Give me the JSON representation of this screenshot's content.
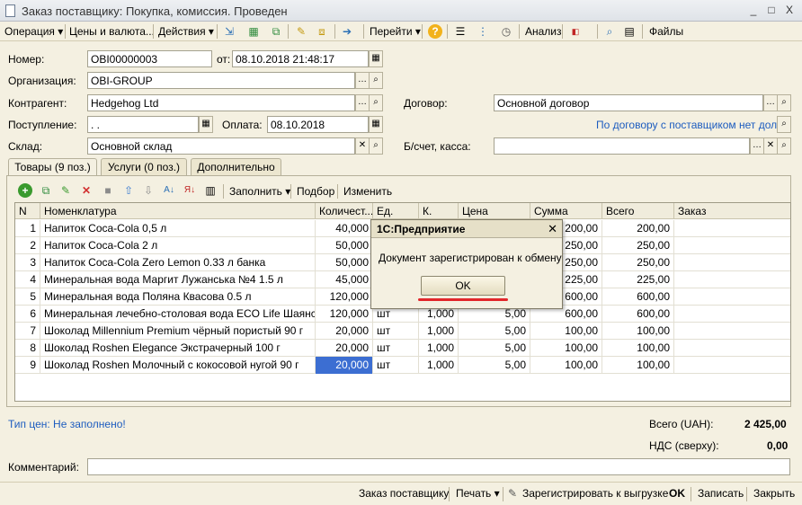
{
  "window": {
    "title": "Заказ поставщику: Покупка, комиссия. Проведен",
    "min": "_",
    "max": "□",
    "close": "X"
  },
  "toolbar": {
    "operation": "Операция ▾",
    "prices": "Цены и валюта...",
    "actions": "Действия ▾",
    "goto": "Перейти ▾",
    "analysis": "Анализ",
    "files": "Файлы",
    "help_glyph": "?"
  },
  "form": {
    "number_label": "Номер:",
    "number_value": "OBI00000003",
    "from_label": "от:",
    "date_value": "08.10.2018 21:48:17",
    "org_label": "Организация:",
    "org_value": "OBI-GROUP",
    "contractor_label": "Контрагент:",
    "contractor_value": "Hedgehog Ltd",
    "contract_label": "Договор:",
    "contract_value": "Основной договор",
    "receipt_label": "Поступление:",
    "receipt_value": " .  .",
    "payment_label": "Оплата:",
    "payment_value": "08.10.2018",
    "debt_link": "По договору с поставщиком нет долга",
    "warehouse_label": "Склад:",
    "warehouse_value": "Основной склад",
    "account_label": "Б/счет, касса:",
    "account_value": ""
  },
  "tabs": [
    {
      "label": "Товары (9 поз.)"
    },
    {
      "label": "Услуги (0 поз.)"
    },
    {
      "label": "Дополнительно"
    }
  ],
  "table_toolbar": {
    "fill": "Заполнить ▾",
    "pick": "Подбор",
    "change": "Изменить"
  },
  "columns": [
    "N",
    "Номенклатура",
    "Количест...",
    "Ед.",
    "К.",
    "Цена",
    "Сумма",
    "Всего",
    "Заказ"
  ],
  "rows": [
    {
      "n": "1",
      "name": "Напиток Coca-Cola 0,5 л",
      "qty": "40,000",
      "unit": "",
      "k": "",
      "price": "",
      "sum": "200,00",
      "total": "200,00"
    },
    {
      "n": "2",
      "name": "Напиток Coca-Cola 2 л",
      "qty": "50,000",
      "unit": "",
      "k": "",
      "price": "",
      "sum": "250,00",
      "total": "250,00"
    },
    {
      "n": "3",
      "name": "Напиток Coca-Cola Zero Lemon 0.33 л банка",
      "qty": "50,000",
      "unit": "",
      "k": "",
      "price": "",
      "sum": "250,00",
      "total": "250,00"
    },
    {
      "n": "4",
      "name": "Минеральная вода Маргит Лужанська №4 1.5 л",
      "qty": "45,000",
      "unit": "",
      "k": "",
      "price": "",
      "sum": "225,00",
      "total": "225,00"
    },
    {
      "n": "5",
      "name": "Минеральная вода Поляна Квасова 0.5 л",
      "qty": "120,000",
      "unit": "",
      "k": "",
      "price": "",
      "sum": "600,00",
      "total": "600,00"
    },
    {
      "n": "6",
      "name": "Минеральная лечебно-столовая вода ECO Life Шаянска...",
      "qty": "120,000",
      "unit": "шт",
      "k": "1,000",
      "price": "5,00",
      "sum": "600,00",
      "total": "600,00"
    },
    {
      "n": "7",
      "name": "Шоколад Millennium Premium чёрный пористый 90 г",
      "qty": "20,000",
      "unit": "шт",
      "k": "1,000",
      "price": "5,00",
      "sum": "100,00",
      "total": "100,00"
    },
    {
      "n": "8",
      "name": "Шоколад Roshen Elegance Экстрачерный 100 г",
      "qty": "20,000",
      "unit": "шт",
      "k": "1,000",
      "price": "5,00",
      "sum": "100,00",
      "total": "100,00"
    },
    {
      "n": "9",
      "name": "Шоколад Roshen Молочный с кокосовой нугой 90 г",
      "qty": "20,000",
      "unit": "шт",
      "k": "1,000",
      "price": "5,00",
      "sum": "100,00",
      "total": "100,00"
    }
  ],
  "footer": {
    "price_type_link": "Тип цен: Не заполнено!",
    "total_label": "Всего (UAH):",
    "total_value": "2 425,00",
    "vat_label": "НДС (сверху):",
    "vat_value": "0,00",
    "comment_label": "Комментарий:",
    "comment_value": ""
  },
  "dialog": {
    "title": "1С:Предприятие",
    "message": "Документ зарегистрирован к обмену",
    "ok": "OK",
    "close": "✕"
  },
  "bottom": {
    "supplier_order": "Заказ поставщику",
    "print": "Печать ▾",
    "register": "Зарегистрировать к выгрузке",
    "ok": "OK",
    "save": "Записать",
    "close": "Закрыть"
  },
  "colors": {
    "accent_link": "#1d5cbf",
    "selection": "#3c6ed2",
    "highlight": "#e2262b"
  }
}
